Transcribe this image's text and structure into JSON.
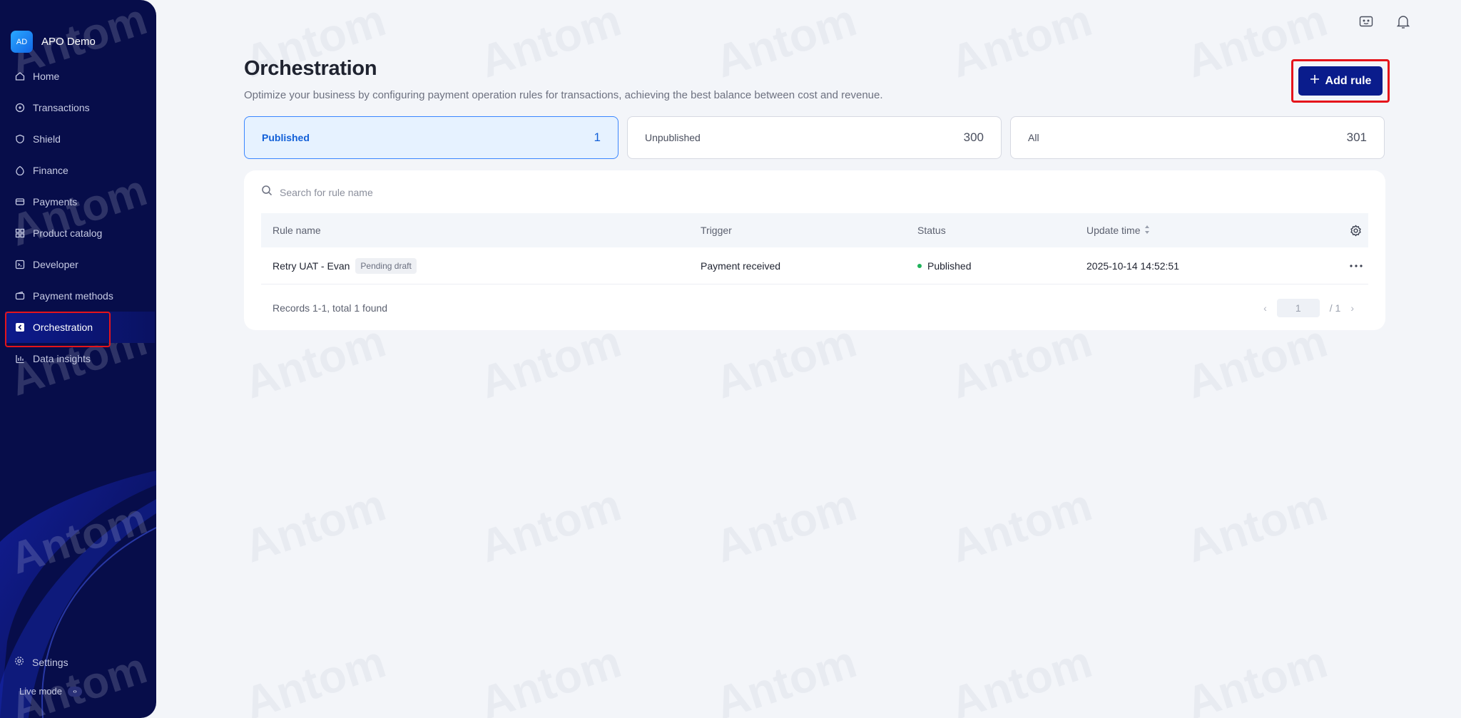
{
  "app": {
    "logo_text": "AD",
    "name": "APO Demo"
  },
  "sidebar": {
    "items": [
      {
        "label": "Home",
        "icon": "home-icon"
      },
      {
        "label": "Transactions",
        "icon": "transactions-icon"
      },
      {
        "label": "Shield",
        "icon": "shield-icon"
      },
      {
        "label": "Finance",
        "icon": "finance-icon"
      },
      {
        "label": "Payments",
        "icon": "payments-icon"
      },
      {
        "label": "Product catalog",
        "icon": "catalog-icon"
      },
      {
        "label": "Developer",
        "icon": "developer-icon"
      },
      {
        "label": "Payment methods",
        "icon": "payment-methods-icon"
      },
      {
        "label": "Orchestration",
        "icon": "orchestration-icon",
        "active": true
      },
      {
        "label": "Data insights",
        "icon": "data-insights-icon"
      }
    ],
    "settings_label": "Settings",
    "live_mode_label": "Live mode"
  },
  "page": {
    "title": "Orchestration",
    "subtitle": "Optimize your business by configuring payment operation rules for transactions, achieving the best balance between cost and revenue.",
    "add_rule_label": "Add rule"
  },
  "tabs": [
    {
      "label": "Published",
      "count": "1",
      "selected": true
    },
    {
      "label": "Unpublished",
      "count": "300"
    },
    {
      "label": "All",
      "count": "301"
    }
  ],
  "search": {
    "placeholder": "Search for rule name"
  },
  "table": {
    "columns": [
      "Rule name",
      "Trigger",
      "Status",
      "Update time"
    ],
    "rows": [
      {
        "rule_name": "Retry UAT - Evan",
        "badge": "Pending draft",
        "trigger": "Payment received",
        "status": "Published",
        "update_time": "2025-10-14 14:52:51"
      }
    ]
  },
  "footer": {
    "records": "Records 1-1, total 1 found",
    "page": "1",
    "total_pages": "/ 1"
  },
  "watermark": "Antom",
  "colors": {
    "sidebar_bg": "#070d4a",
    "accent": "#0a1c8c",
    "selected_tab": "#e6f2ff",
    "status_green": "#1fb25a",
    "highlight_red": "#e5141b"
  }
}
